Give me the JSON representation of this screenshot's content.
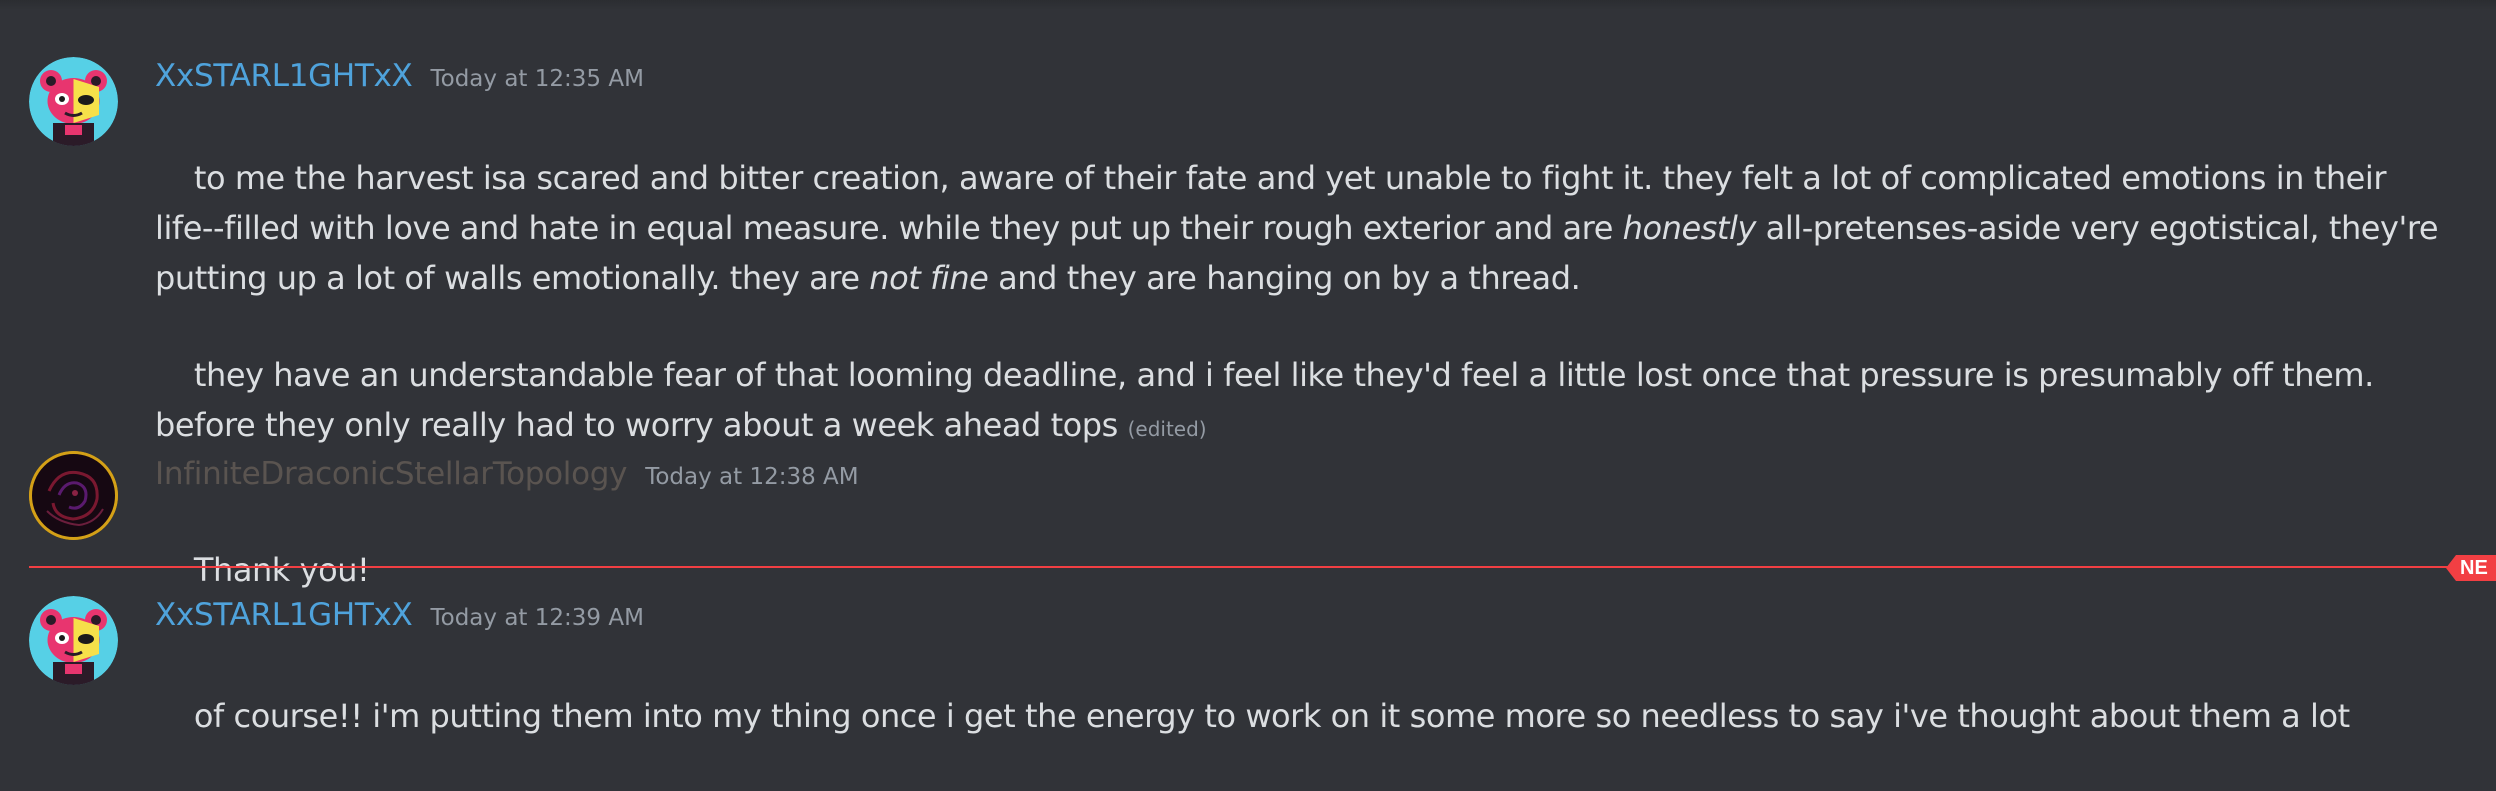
{
  "colors": {
    "background": "#313338",
    "message_text": "#dbdee1",
    "timestamp": "#949ba4",
    "username_starlight": "#4fa3dc",
    "username_infinite": "#5a5450",
    "new_divider": "#f23f43"
  },
  "messages": [
    {
      "author": "XxSTARL1GHTxX",
      "timestamp": "Today at 12:35 AM",
      "avatar_icon": "pink-bear-avatar-icon",
      "paragraphs": [
        {
          "t1": "to me the harvest isa scared and bitter creation, aware of their fate and yet unable to fight it. they felt a lot of complicated emotions in their life--filled with love and hate in equal measure. while they put up their rough exterior and are ",
          "em1": "honestly",
          "t2": " all-pretenses-aside very egotistical, they're putting up a lot of walls emotionally. they are ",
          "em2": "not fine",
          "t3": " and they are hanging on by a thread."
        },
        {
          "t1": "they have an understandable fear of that looming deadline, and i feel like they'd feel a little lost once that pressure is presumably off them. before they only really had to worry about a week ahead tops ",
          "edited": "(edited)"
        }
      ]
    },
    {
      "author": "InfiniteDraconicStellarTopology",
      "timestamp": "Today at 12:38 AM",
      "avatar_icon": "dark-dragon-avatar-icon",
      "text": "Thank you!"
    },
    {
      "author": "XxSTARL1GHTxX",
      "timestamp": "Today at 12:39 AM",
      "avatar_icon": "pink-bear-avatar-icon",
      "text": "of course!! i'm putting them into my thing once i get the energy to work on it some more so needless to say i've thought about them a lot"
    }
  ],
  "new_messages_divider": {
    "label": "NE"
  }
}
